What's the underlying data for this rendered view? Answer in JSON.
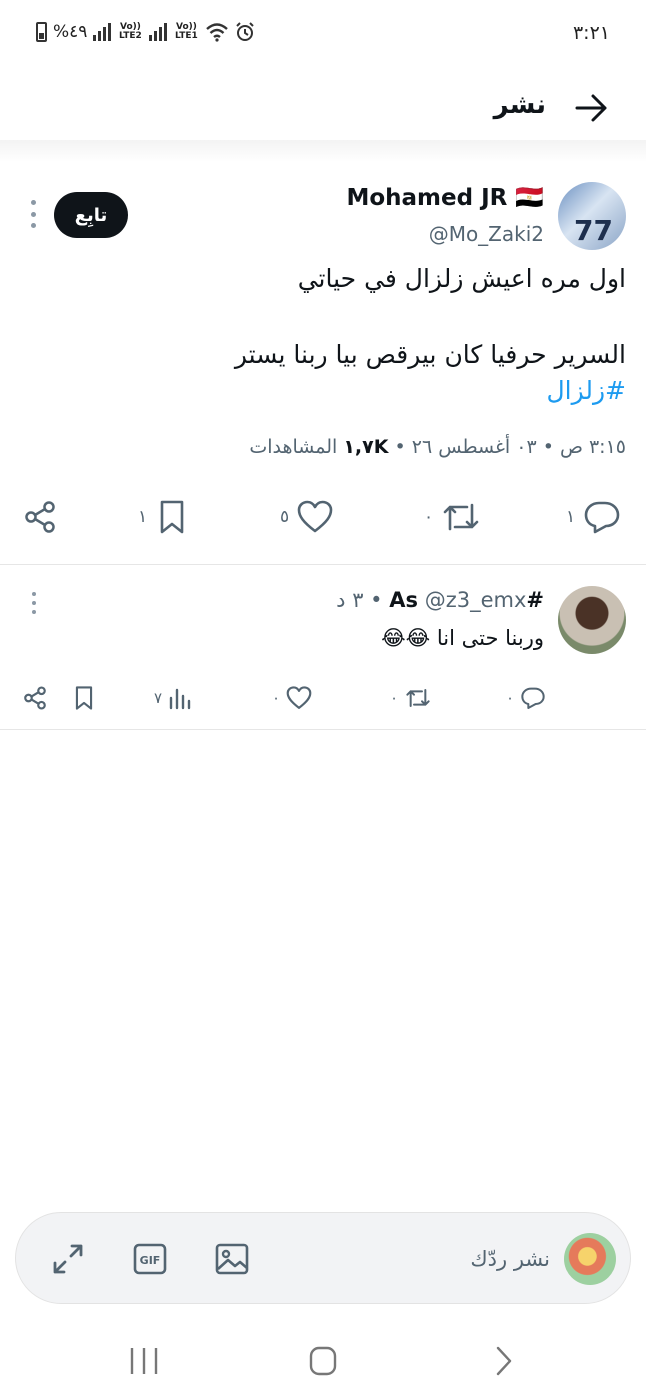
{
  "status_bar": {
    "time": "٣:٢١",
    "battery_percent": "%٤٩",
    "sim1_label": "Vo)) LTE2",
    "sim2_label": "Vo)) LTE1"
  },
  "header": {
    "title": "نشر",
    "back_icon": "arrow-right-icon"
  },
  "main_tweet": {
    "author_name": "Mohamed JR 🇪🇬",
    "author_handle": "@Mo_Zaki2",
    "follow_label": "تابِع",
    "avatar_jersey_number": "77",
    "text_line1": "اول مره اعيش زلزال في حياتي",
    "text_line2": "السرير حرفيا كان بيرقص بيا ربنا يستر",
    "hashtag": "#زلزال",
    "meta": "٣:١٥ ص • ٠٣ أغسطس ٢٦ •",
    "views_count": "١,٧K",
    "views_label": "المشاهدات",
    "actions": {
      "replies": "١",
      "retweets": "٠",
      "likes": "٥",
      "bookmarks": "١"
    }
  },
  "reply": {
    "author_name": "#As",
    "author_handle": "@z3_emx",
    "time": "• ٣ د",
    "text": "وربنا حتى انا 😂😂",
    "actions": {
      "replies": "٠",
      "retweets": "٠",
      "likes": "٠",
      "views": "٧"
    }
  },
  "composer": {
    "placeholder": "نشر ردّك"
  }
}
